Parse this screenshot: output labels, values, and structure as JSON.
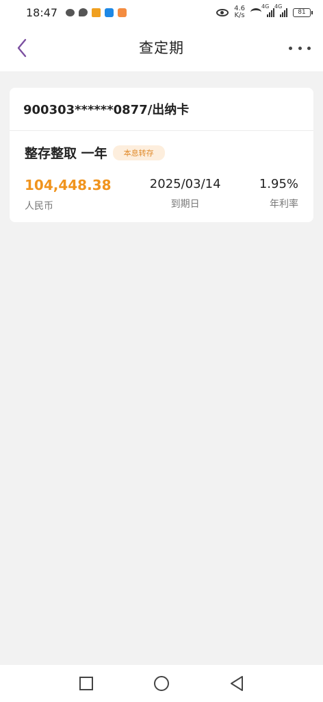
{
  "status_bar": {
    "time": "18:47",
    "speed_value": "4.6",
    "speed_unit": "K/s",
    "signal_1": "4G",
    "signal_2": "4G",
    "battery": "81"
  },
  "header": {
    "title": "查定期"
  },
  "account": {
    "label": "900303******0877/出纳卡"
  },
  "deposit": {
    "type": "整存整取 一年",
    "badge": "本息转存",
    "amount": "104,448.38",
    "currency": "人民币",
    "maturity_date": "2025/03/14",
    "maturity_label": "到期日",
    "rate": "1.95%",
    "rate_label": "年利率"
  },
  "colors": {
    "accent": "#f0941e",
    "back_arrow": "#7b4fa0",
    "badge_bg": "#fdeedd"
  }
}
